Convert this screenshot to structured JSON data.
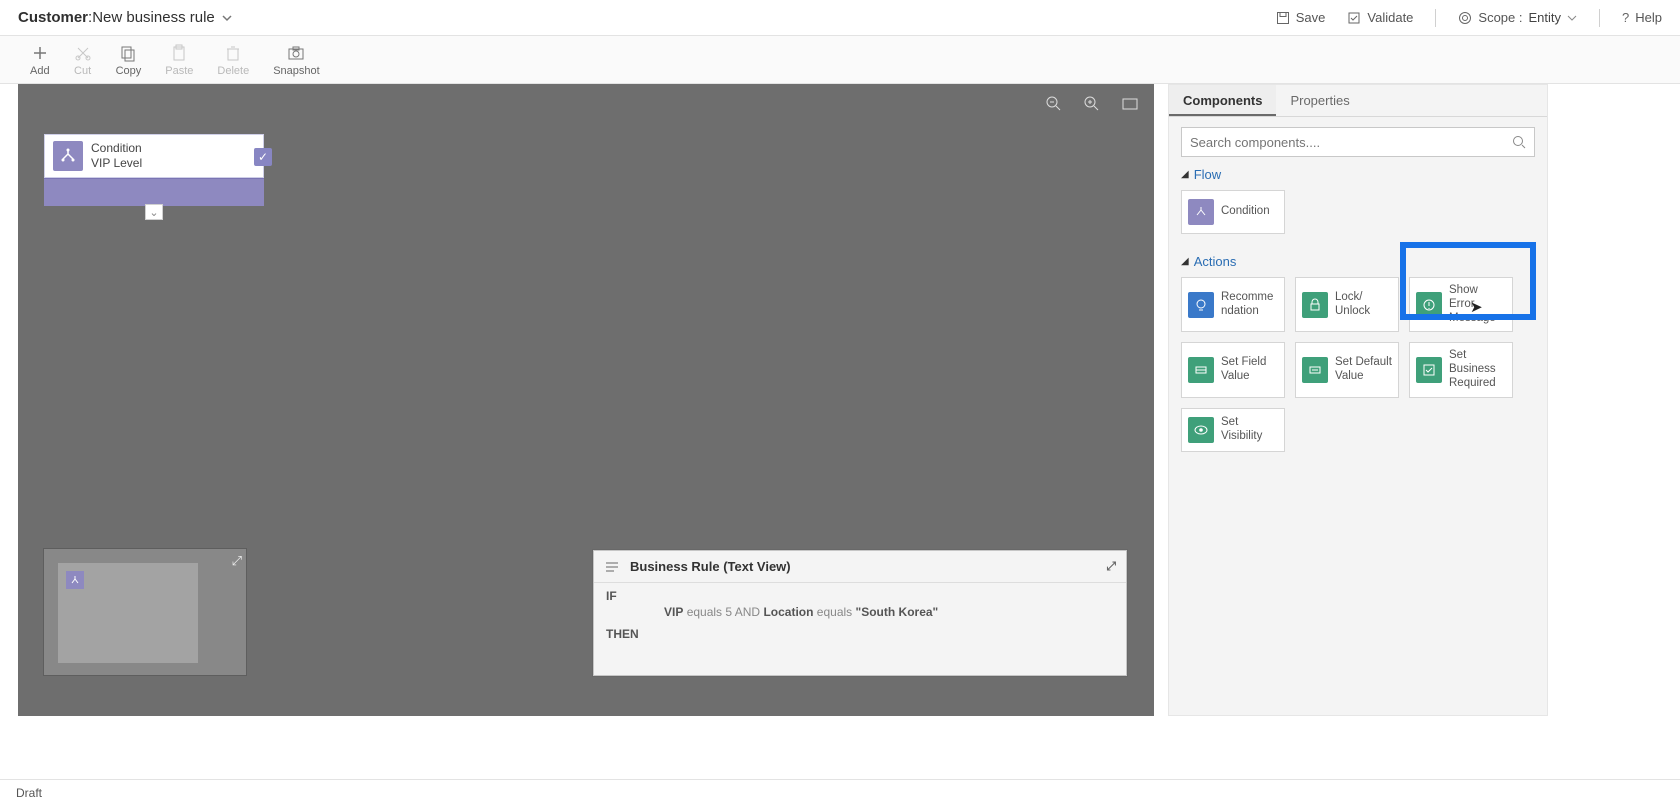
{
  "header": {
    "entity": "Customer",
    "title": "New business rule",
    "save": "Save",
    "validate": "Validate",
    "scope_label": "Scope :",
    "scope_value": "Entity",
    "help": "Help"
  },
  "toolbar": {
    "add": "Add",
    "cut": "Cut",
    "copy": "Copy",
    "paste": "Paste",
    "delete": "Delete",
    "snapshot": "Snapshot"
  },
  "canvas": {
    "condition": {
      "type": "Condition",
      "name": "VIP Level"
    }
  },
  "textview": {
    "title": "Business Rule (Text View)",
    "if": "IF",
    "then": "THEN",
    "rule": {
      "f1": "VIP",
      "op1": "equals",
      "v1": "5",
      "conj": "AND",
      "f2": "Location",
      "op2": "equals",
      "v2": "\"South Korea\""
    }
  },
  "rightpanel": {
    "tabs": {
      "components": "Components",
      "properties": "Properties"
    },
    "search_placeholder": "Search components....",
    "groups": {
      "flow": "Flow",
      "actions": "Actions"
    },
    "tiles": {
      "condition": "Condition",
      "recommendation": "Recomme\nndation",
      "lock": "Lock/\nUnlock",
      "error": "Show Error\nMessage",
      "setfield": "Set Field\nValue",
      "setdefault": "Set Default\nValue",
      "bizreq": "Set\nBusiness\nRequired",
      "visibility": "Set\nVisibility"
    }
  },
  "footer": {
    "status": "Draft"
  }
}
